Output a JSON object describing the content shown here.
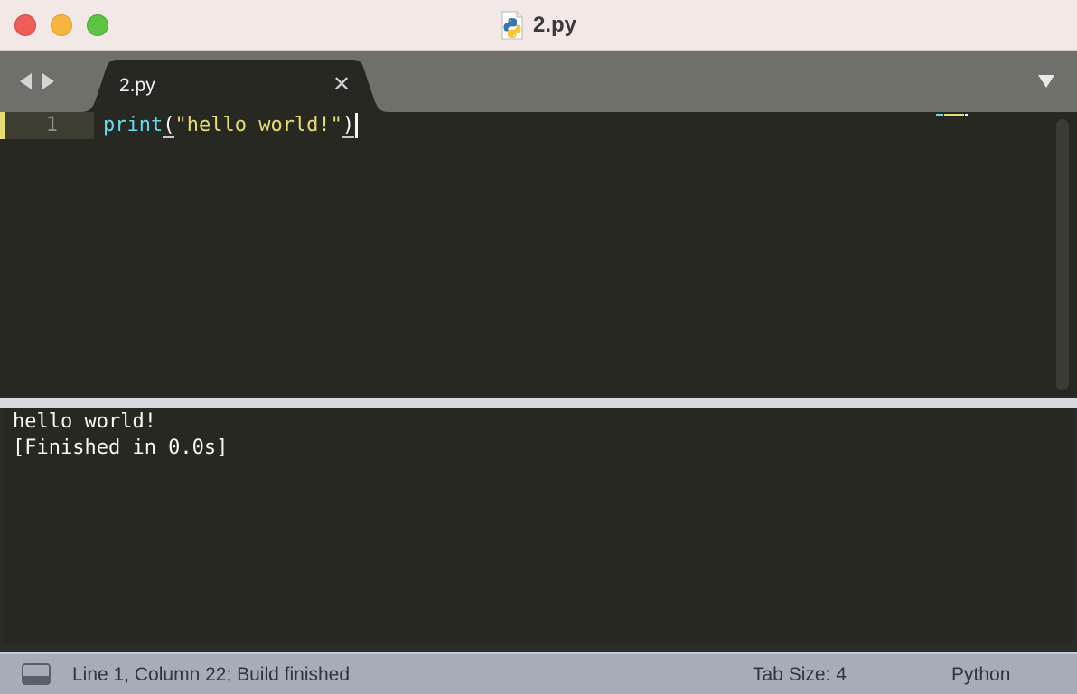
{
  "window": {
    "title": "2.py",
    "file_icon": "python-file-icon"
  },
  "tabs": [
    {
      "label": "2.py",
      "active": true,
      "close_icon": "close-icon"
    }
  ],
  "editor": {
    "line_numbers": [
      "1"
    ],
    "code": {
      "func": "print",
      "open_paren": "(",
      "string": "\"hello world!\"",
      "close_paren": ")"
    },
    "colors": {
      "background": "#272822",
      "keyword": "#66d9ef",
      "string": "#e6db74",
      "text": "#f8f8f2"
    }
  },
  "output": {
    "lines": [
      "hello world!",
      "[Finished in 0.0s]"
    ]
  },
  "status_bar": {
    "position_text": "Line 1, Column 22; Build finished",
    "tab_size": "Tab Size: 4",
    "syntax": "Python",
    "panel_icon": "panel-toggle-icon"
  }
}
